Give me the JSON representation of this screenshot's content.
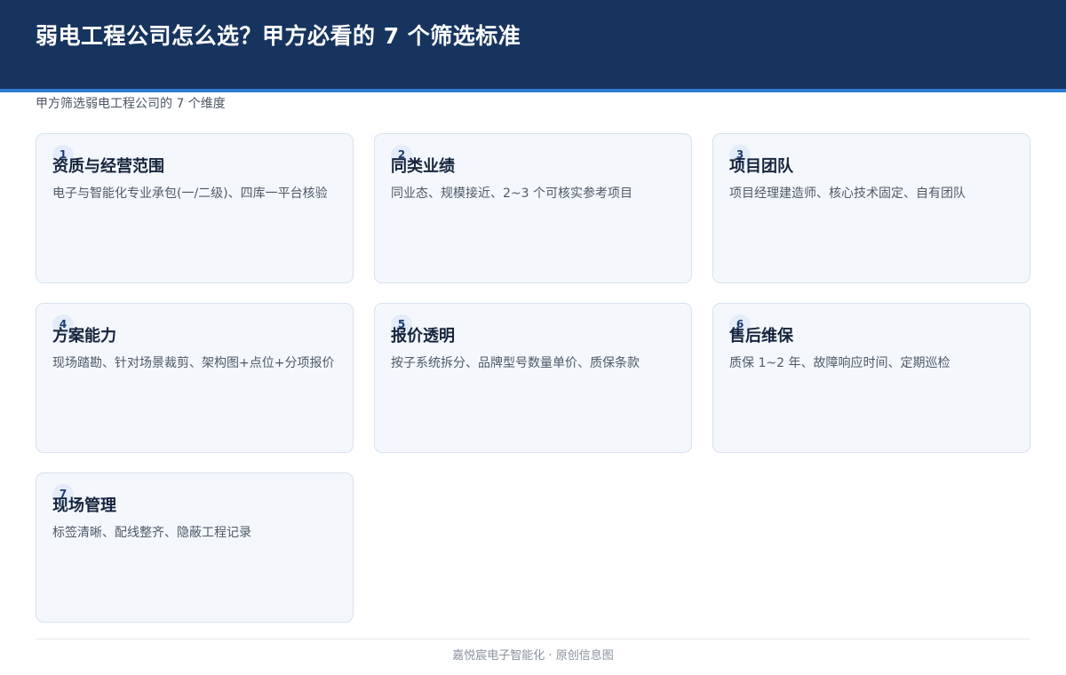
{
  "header": {
    "title": "弱电工程公司怎么选？甲方必看的 7 个筛选标准"
  },
  "subtitle": "甲方筛选弱电工程公司的 7 个维度",
  "cards": [
    {
      "num": "1",
      "title": "资质与经营范围",
      "desc": "电子与智能化专业承包(一/二级)、四库一平台核验"
    },
    {
      "num": "2",
      "title": "同类业绩",
      "desc": "同业态、规模接近、2~3 个可核实参考项目"
    },
    {
      "num": "3",
      "title": "项目团队",
      "desc": "项目经理建造师、核心技术固定、自有团队"
    },
    {
      "num": "4",
      "title": "方案能力",
      "desc": "现场踏勘、针对场景裁剪、架构图+点位+分项报价"
    },
    {
      "num": "5",
      "title": "报价透明",
      "desc": "按子系统拆分、品牌型号数量单价、质保条款"
    },
    {
      "num": "6",
      "title": "售后维保",
      "desc": "质保 1~2 年、故障响应时间、定期巡检"
    },
    {
      "num": "7",
      "title": "现场管理",
      "desc": "标签清晰、配线整齐、隐蔽工程记录"
    }
  ],
  "footer": {
    "text": "嘉悦宸电子智能化 · 原创信息图"
  },
  "colors": {
    "header_bg": "#17345f",
    "header_accent": "#2e7bd1",
    "card_bg": "#f4f8fc",
    "card_border": "#d7e1ee"
  }
}
